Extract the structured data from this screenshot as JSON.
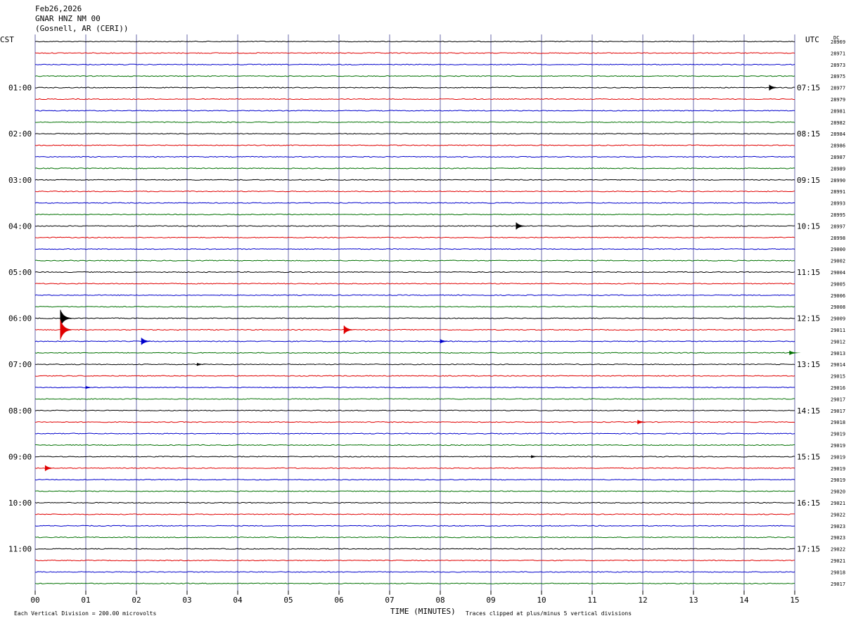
{
  "header": {
    "date": "Feb26,2026",
    "station": "GNAR HNZ NM 00",
    "location": "(Gosnell, AR (CERI))"
  },
  "left_axis_label": "CST",
  "right_axis_label": "UTC",
  "dc_label": "DC",
  "footer": {
    "scale_note": "Each Vertical Division =  200.00 microvolts",
    "xlabel": "TIME (MINUTES)",
    "clip_note": "Traces clipped at plus/minus 5 vertical divisions"
  },
  "colors": {
    "trace_cycle": [
      "#000000",
      "#e00000",
      "#0000cc",
      "#007000"
    ],
    "grid": "#6a6aaa"
  },
  "chart_data": {
    "type": "line",
    "title": "GNAR HNZ NM 00",
    "xlabel": "TIME (MINUTES)",
    "xlim": [
      0,
      15
    ],
    "x_ticks": [
      "00",
      "01",
      "02",
      "03",
      "04",
      "05",
      "06",
      "07",
      "08",
      "09",
      "10",
      "11",
      "12",
      "13",
      "14",
      "15"
    ],
    "rows_per_hour": 4,
    "row_minutes": 15,
    "left_hour_labels": [
      "01:00",
      "02:00",
      "03:00",
      "04:00",
      "05:00",
      "06:00",
      "07:00",
      "08:00",
      "09:00",
      "10:00",
      "11:00"
    ],
    "right_hour_labels": [
      "07:15",
      "08:15",
      "09:15",
      "10:15",
      "11:15",
      "12:15",
      "13:15",
      "14:15",
      "15:15",
      "16:15",
      "17:15"
    ],
    "dc_offsets": [
      "28969",
      "28971",
      "28973",
      "28975",
      "28977",
      "28979",
      "28981",
      "28982",
      "28984",
      "28986",
      "28987",
      "28989",
      "28990",
      "28991",
      "28993",
      "28995",
      "28997",
      "28998",
      "29000",
      "29002",
      "29004",
      "29005",
      "29006",
      "29008",
      "29009",
      "29011",
      "29012",
      "29013",
      "29014",
      "29015",
      "29016",
      "29017",
      "29017",
      "29018",
      "29019",
      "29019",
      "29019",
      "29019",
      "29019",
      "29020",
      "29021",
      "29022",
      "29023",
      "29023",
      "29022",
      "29021",
      "29018",
      "29017"
    ],
    "events": [
      {
        "row": 4,
        "minute": 14.5,
        "amp": 4
      },
      {
        "row": 16,
        "minute": 9.5,
        "amp": 5
      },
      {
        "row": 24,
        "minute": 0.5,
        "amp": 12
      },
      {
        "row": 25,
        "minute": 0.5,
        "amp": 14
      },
      {
        "row": 25,
        "minute": 6.1,
        "amp": 6
      },
      {
        "row": 26,
        "minute": 2.1,
        "amp": 5
      },
      {
        "row": 26,
        "minute": 8.0,
        "amp": 3
      },
      {
        "row": 27,
        "minute": 14.9,
        "amp": 3
      },
      {
        "row": 28,
        "minute": 3.2,
        "amp": 2
      },
      {
        "row": 30,
        "minute": 1.0,
        "amp": 2
      },
      {
        "row": 33,
        "minute": 11.9,
        "amp": 3
      },
      {
        "row": 36,
        "minute": 9.8,
        "amp": 2
      },
      {
        "row": 37,
        "minute": 0.2,
        "amp": 4
      }
    ]
  }
}
